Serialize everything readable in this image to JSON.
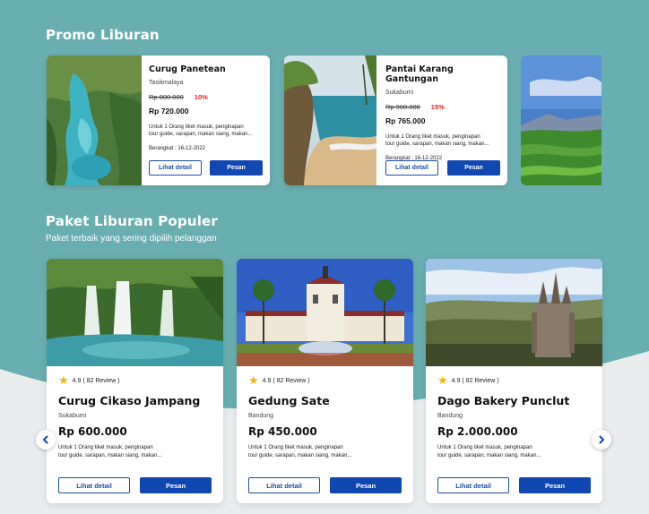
{
  "promo": {
    "title": "Promo Liburan",
    "cards": [
      {
        "title": "Curug Panetean",
        "location": "Tasikmalaya",
        "old_price": "Rp 800.000",
        "discount": "10%",
        "price": "Rp 720.000",
        "desc_line1": "Untuk 1 Orang tiket masuk, penginapan",
        "desc_line2": "tour guide, sarapan, makan siang, makan...",
        "date": "Berangkat : 16-12-2022",
        "detail_label": "Lihat detail",
        "order_label": "Pesan"
      },
      {
        "title": "Pantai Karang Gantungan",
        "location": "Sukabumi",
        "old_price": "Rp 900.000",
        "discount": "15%",
        "price": "Rp 765.000",
        "desc_line1": "Untuk 1 Orang tiket masuk, penginapan",
        "desc_line2": "tour guide, sarapan, makan siang, makan...",
        "date": "Berangkat : 16-12-2022",
        "detail_label": "Lihat detail",
        "order_label": "Pesan"
      }
    ]
  },
  "popular": {
    "title": "Paket Liburan Populer",
    "subtitle": "Paket terbaik yang sering dipilih pelanggan",
    "cards": [
      {
        "rating": "4.9 ( 82 Review )",
        "title": "Curug Cikaso Jampang",
        "location": "Sukabumi",
        "price": "Rp 600.000",
        "desc_line1": "Untuk 1 Orang tiket masuk, penginapan",
        "desc_line2": "tour guide, sarapan, makan siang, makan...",
        "detail_label": "Lihat detail",
        "order_label": "Pesan"
      },
      {
        "rating": "4.9 ( 82 Review )",
        "title": "Gedung Sate",
        "location": "Bandung",
        "price": "Rp 450.000",
        "desc_line1": "Untuk 1 Orang tiket masuk, penginapan",
        "desc_line2": "tour guide, sarapan, makan siang, makan...",
        "detail_label": "Lihat detail",
        "order_label": "Pesan"
      },
      {
        "rating": "4.9 ( 82 Review )",
        "title": "Dago Bakery Punclut",
        "location": "Bandung",
        "price": "Rp 2.000.000",
        "desc_line1": "Untuk 1 Orang tiket masuk, penginapan",
        "desc_line2": "tour guide, sarapan, makan siang, makan...",
        "detail_label": "Lihat detail",
        "order_label": "Pesan"
      }
    ],
    "prev_icon": "chevron-left-icon",
    "next_icon": "chevron-right-icon"
  },
  "colors": {
    "background": "#69aeb0",
    "primary_button": "#1147b0",
    "discount": "#e02424",
    "star": "#f2b705"
  }
}
